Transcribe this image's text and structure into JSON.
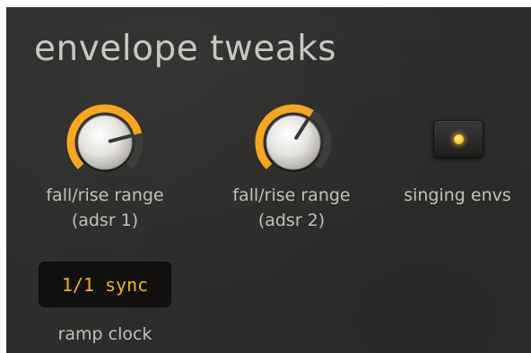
{
  "title": "envelope tweaks",
  "colors": {
    "accent": "#f5a623",
    "background": "#2f2e2c",
    "label": "#c2c0bb",
    "display_text": "#f0b51e"
  },
  "knobs": [
    {
      "label_line1": "fall/rise range",
      "label_line2": "(adsr 1)",
      "value": 0.78
    },
    {
      "label_line1": "fall/rise range",
      "label_line2": "(adsr 2)",
      "value": 0.62
    }
  ],
  "singing_envs": {
    "label": "singing envs",
    "led_on": true,
    "icon": "led-indicator-icon"
  },
  "ramp_clock": {
    "value": "1/1 sync",
    "label": "ramp clock"
  }
}
